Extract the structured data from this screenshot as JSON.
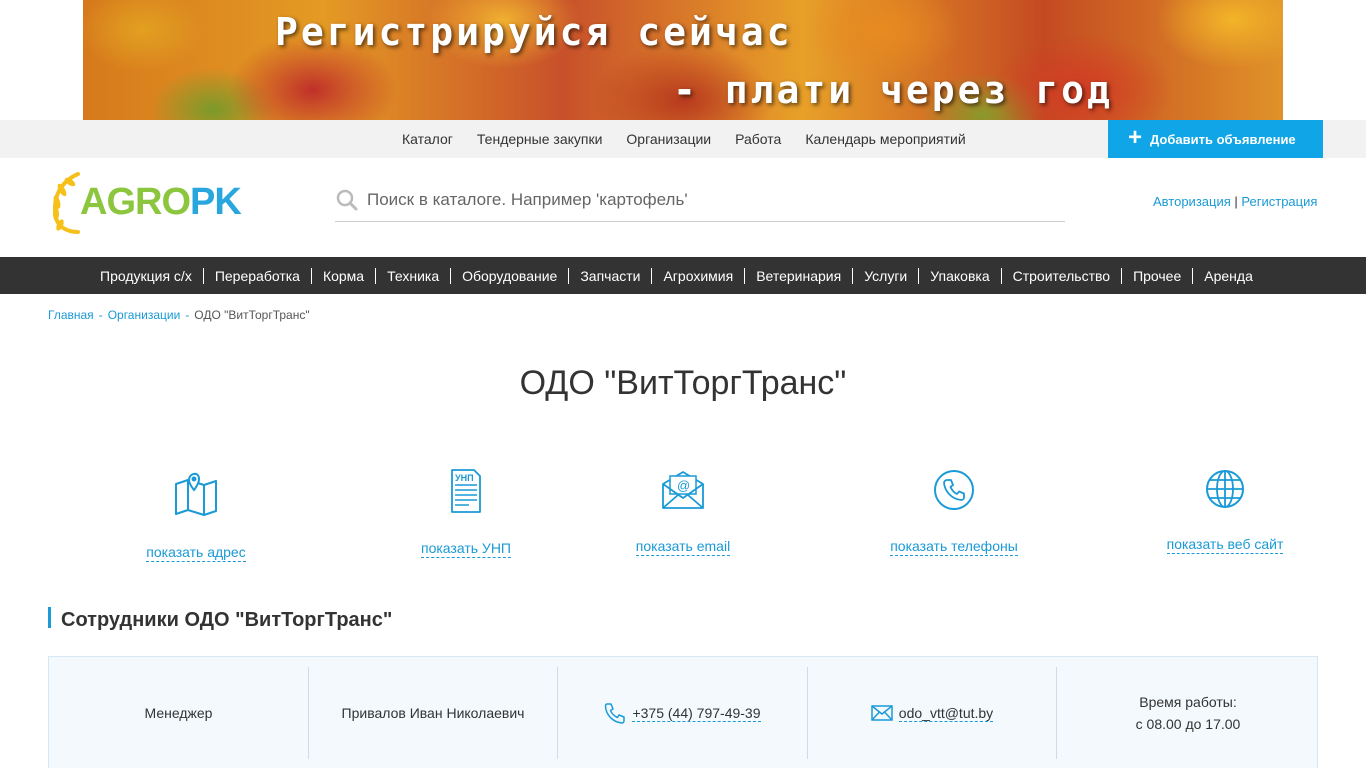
{
  "banner": {
    "line1": "Регистрируйся сейчас",
    "line2": "- плати через год"
  },
  "topnav": {
    "links": [
      "Каталог",
      "Тендерные закупки",
      "Организации",
      "Работа",
      "Календарь мероприятий"
    ],
    "add_button": "Добавить объявление"
  },
  "header": {
    "logo_agro": "AGRO",
    "logo_pk": "PK",
    "search_placeholder": "Поиск в каталоге. Например 'картофель'",
    "auth_login": "Авторизация",
    "auth_sep": "|",
    "auth_register": "Регистрация"
  },
  "categories": [
    "Продукция с/х",
    "Переработка",
    "Корма",
    "Техника",
    "Оборудование",
    "Запчасти",
    "Агрохимия",
    "Ветеринария",
    "Услуги",
    "Упаковка",
    "Строительство",
    "Прочее",
    "Аренда"
  ],
  "breadcrumbs": {
    "home": "Главная",
    "orgs": "Организации",
    "current": "ОДО \"ВитТоргТранс\"",
    "sep": "-"
  },
  "page": {
    "title": "ОДО \"ВитТоргТранс\""
  },
  "info": {
    "address": "показать адрес",
    "unp": "показать УНП",
    "unp_icon_label": "УНП",
    "email": "показать email",
    "phones": "показать телефоны",
    "website": "показать веб сайт"
  },
  "staff_section": {
    "title": "Сотрудники ОДО \"ВитТоргТранс\""
  },
  "staff": {
    "position": "Менеджер",
    "name": "Привалов Иван Николаевич",
    "phone": "+375 (44) 797-49-39",
    "email": "odo_vtt@tut.by",
    "hours_label": "Время работы:",
    "hours_value": "с 08.00 до 17.00"
  },
  "colors": {
    "accent": "#1a9ad6",
    "button": "#0fa5e6",
    "catbar": "#333333",
    "logo_green": "#8cc63f"
  }
}
